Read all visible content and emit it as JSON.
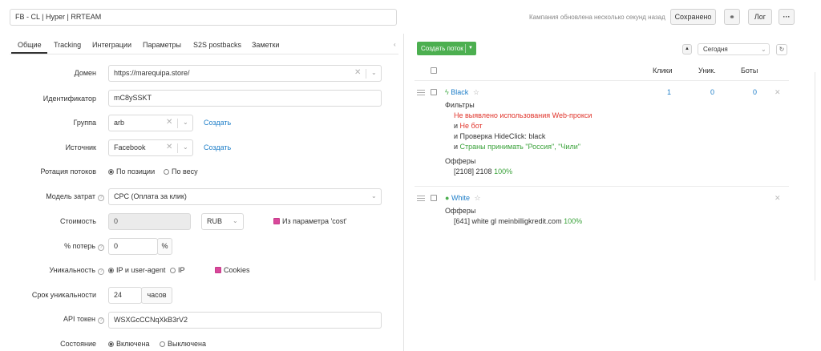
{
  "header": {
    "campaign_name": "FB - CL | Hyper | RRTEAM",
    "updated_text": "Кампания обновлена несколько секунд назад",
    "saved_label": "Сохранено",
    "log_label": "Лог",
    "more_label": "···"
  },
  "tabs": [
    "Общие",
    "Tracking",
    "Интеграции",
    "Параметры",
    "S2S postbacks",
    "Заметки"
  ],
  "form": {
    "domain": {
      "label": "Домен",
      "value": "https://marequipa.store/"
    },
    "identifier": {
      "label": "Идентификатор",
      "value": "mC8ySSKT"
    },
    "group": {
      "label": "Группа",
      "value": "arb",
      "create": "Создать"
    },
    "source": {
      "label": "Источник",
      "value": "Facebook",
      "create": "Создать"
    },
    "rotation": {
      "label": "Ротация потоков",
      "options": [
        "По позиции",
        "По весу"
      ]
    },
    "cost_model": {
      "label": "Модель затрат",
      "value": "CPC (Оплата за клик)"
    },
    "cost": {
      "label": "Стоимость",
      "value": "0",
      "currency": "RUB",
      "from_param": "Из параметра 'cost'"
    },
    "loss": {
      "label": "% потерь",
      "value": "0",
      "unit": "%"
    },
    "uniqueness": {
      "label": "Уникальность",
      "options": [
        "IP и user-agent",
        "IP"
      ],
      "cookies": "Cookies"
    },
    "uniq_period": {
      "label": "Срок уникальности",
      "value": "24",
      "unit": "часов"
    },
    "api_token": {
      "label": "API токен",
      "value": "WSXGcCCNqXkB3rV2"
    },
    "state": {
      "label": "Состояние",
      "options": [
        "Включена",
        "Выключена"
      ]
    }
  },
  "streams_panel": {
    "create_button": "Создать поток",
    "period": "Сегодня",
    "columns": [
      "Клики",
      "Уник.",
      "Боты"
    ],
    "streams": [
      {
        "name": "Black",
        "clicks": "1",
        "unique": "0",
        "bots": "0",
        "filters_title": "Фильтры",
        "filters": [
          {
            "prefix": "",
            "text": "Не выявлено использования Web-прокси",
            "color": "red"
          },
          {
            "prefix": "и",
            "text": "Не бот",
            "color": "red"
          },
          {
            "prefix": "и",
            "text": "Проверка HideClick: black",
            "color": "default"
          },
          {
            "prefix": "и",
            "text": "Страны принимать \"Россия\", \"Чили\"",
            "color": "green"
          }
        ],
        "offers_title": "Офферы",
        "offer": "[2108] 2108",
        "offer_pct": "100%"
      },
      {
        "name": "White",
        "offers_title": "Офферы",
        "offer": "[641] white gl meinbilligkredit.com",
        "offer_pct": "100%"
      }
    ]
  },
  "colors": {
    "accent_green": "#4caf50",
    "link_blue": "#1e7ec8",
    "error_red": "#e0342b",
    "checkbox_pink": "#d9489b"
  }
}
